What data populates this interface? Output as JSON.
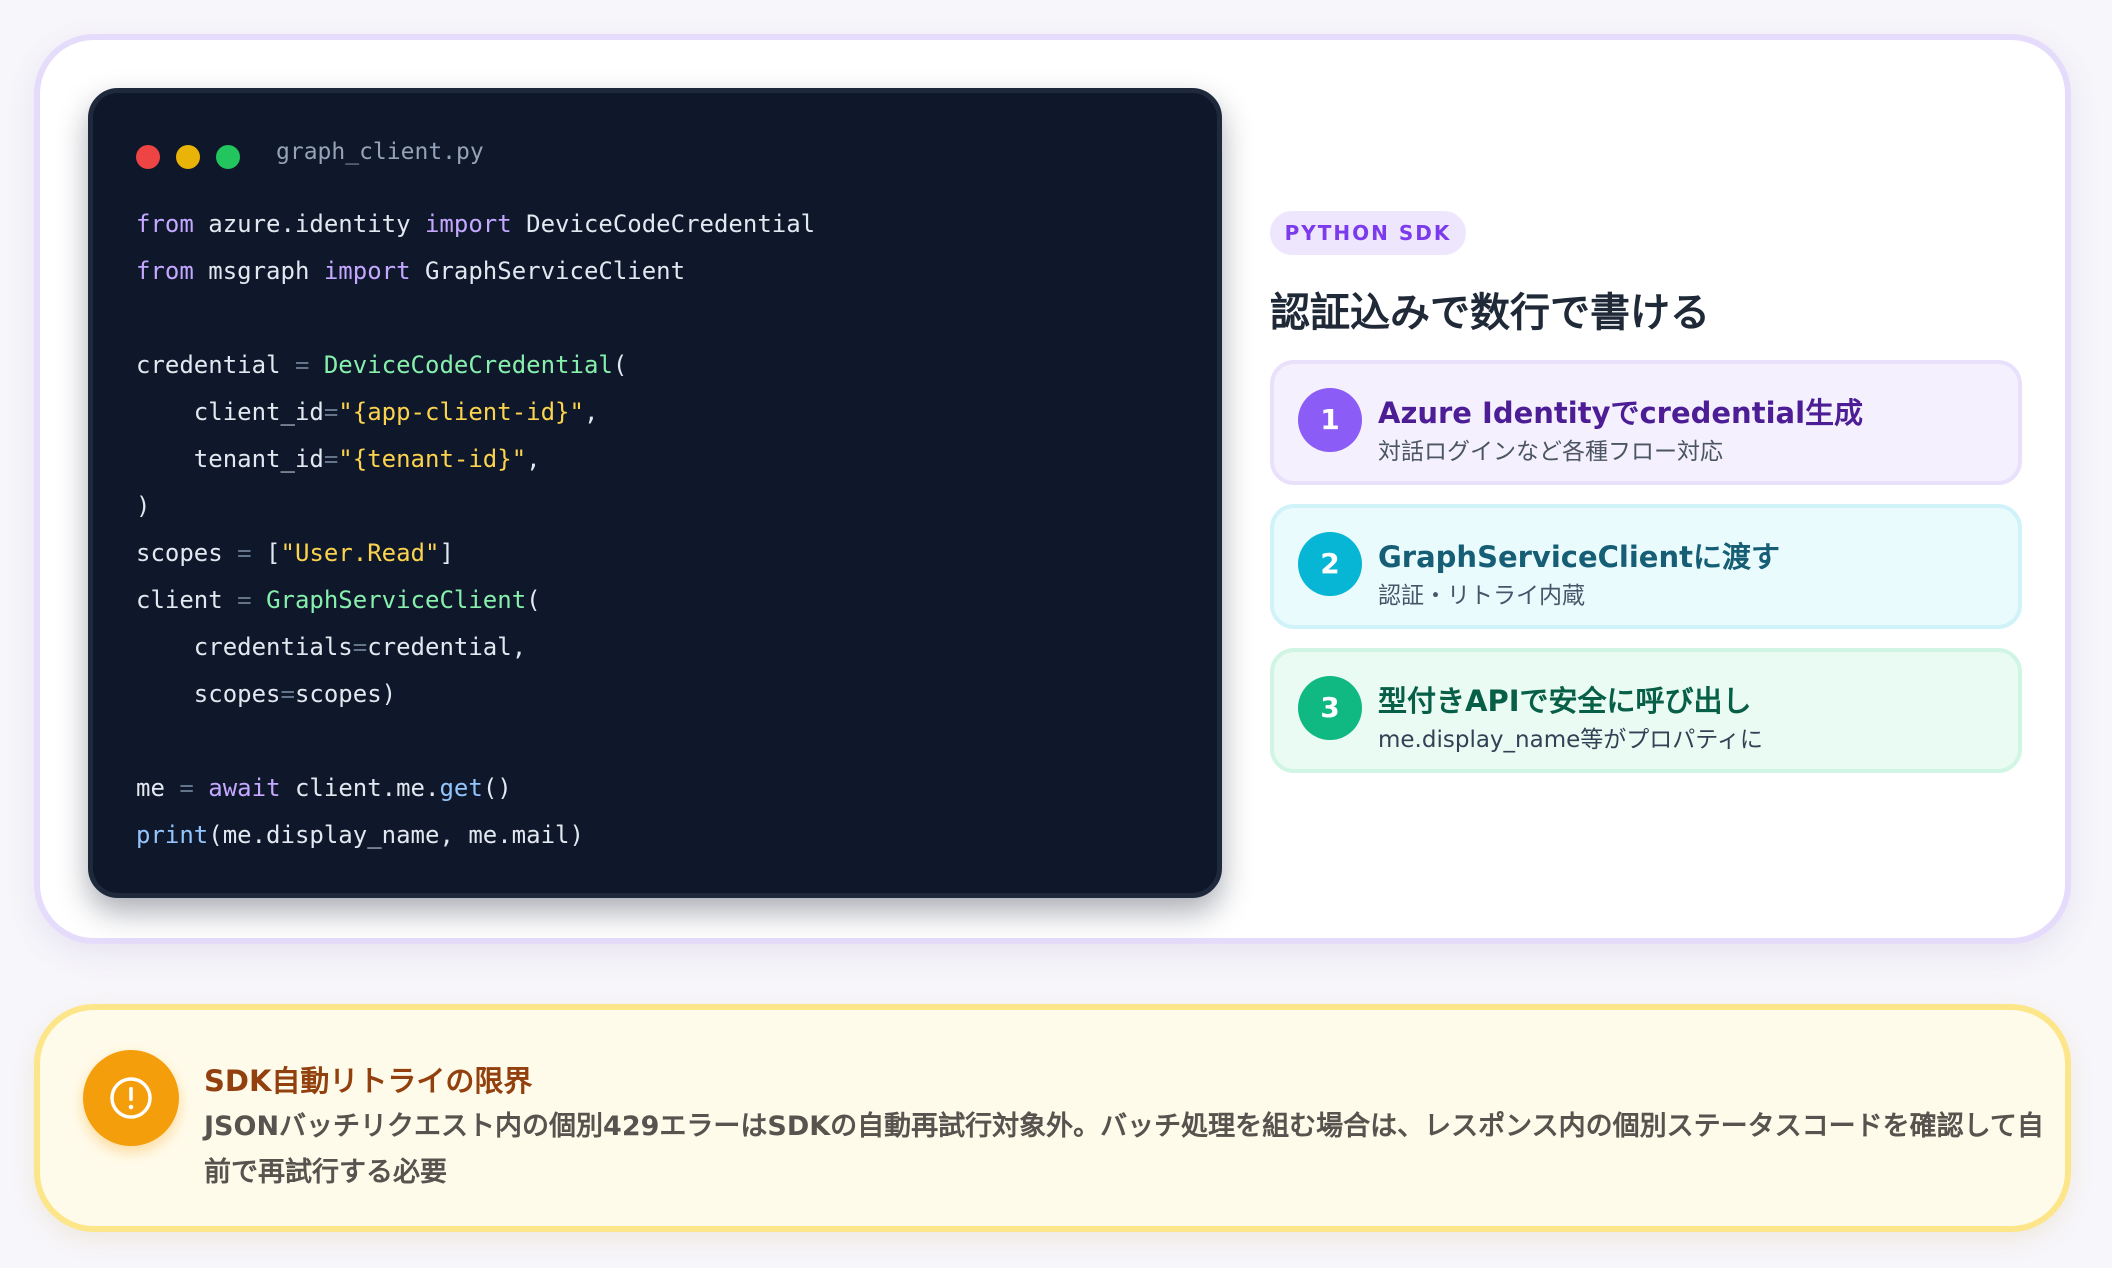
{
  "code_window": {
    "file_name": "graph_client.py",
    "lines": [
      [
        {
          "t": "kw",
          "v": "from"
        },
        {
          "t": "",
          "v": " azure.identity "
        },
        {
          "t": "kw",
          "v": "import"
        },
        {
          "t": "",
          "v": " DeviceCodeCredential"
        }
      ],
      [
        {
          "t": "kw",
          "v": "from"
        },
        {
          "t": "",
          "v": " msgraph "
        },
        {
          "t": "kw",
          "v": "import"
        },
        {
          "t": "",
          "v": " GraphServiceClient"
        }
      ],
      [],
      [
        {
          "t": "",
          "v": "credential "
        },
        {
          "t": "op",
          "v": "="
        },
        {
          "t": "",
          "v": " "
        },
        {
          "t": "fn",
          "v": "DeviceCodeCredential"
        },
        {
          "t": "",
          "v": "("
        }
      ],
      [
        {
          "t": "",
          "v": "    client_id"
        },
        {
          "t": "op",
          "v": "="
        },
        {
          "t": "str",
          "v": "\"{app-client-id}\""
        },
        {
          "t": "",
          "v": ","
        }
      ],
      [
        {
          "t": "",
          "v": "    tenant_id"
        },
        {
          "t": "op",
          "v": "="
        },
        {
          "t": "str",
          "v": "\"{tenant-id}\""
        },
        {
          "t": "",
          "v": ","
        }
      ],
      [
        {
          "t": "",
          "v": ")"
        }
      ],
      [
        {
          "t": "",
          "v": "scopes "
        },
        {
          "t": "op",
          "v": "="
        },
        {
          "t": "",
          "v": " ["
        },
        {
          "t": "str",
          "v": "\"User.Read\""
        },
        {
          "t": "",
          "v": "]"
        }
      ],
      [
        {
          "t": "",
          "v": "client "
        },
        {
          "t": "op",
          "v": "="
        },
        {
          "t": "",
          "v": " "
        },
        {
          "t": "fn",
          "v": "GraphServiceClient"
        },
        {
          "t": "",
          "v": "("
        }
      ],
      [
        {
          "t": "",
          "v": "    credentials"
        },
        {
          "t": "op",
          "v": "="
        },
        {
          "t": "",
          "v": "credential,"
        }
      ],
      [
        {
          "t": "",
          "v": "    scopes"
        },
        {
          "t": "op",
          "v": "="
        },
        {
          "t": "",
          "v": "scopes)"
        }
      ],
      [],
      [
        {
          "t": "",
          "v": "me "
        },
        {
          "t": "op",
          "v": "="
        },
        {
          "t": "",
          "v": " "
        },
        {
          "t": "kw",
          "v": "await"
        },
        {
          "t": "",
          "v": " client.me."
        },
        {
          "t": "call",
          "v": "get"
        },
        {
          "t": "",
          "v": "()"
        }
      ],
      [
        {
          "t": "call",
          "v": "print"
        },
        {
          "t": "",
          "v": "(me.display_name, me.mail)"
        }
      ]
    ]
  },
  "badge": "PYTHON SDK",
  "heading": "認証込みで数行で書ける",
  "steps": [
    {
      "num": "1",
      "title": "Azure Identityでcredential生成",
      "desc": "対話ログインなど各種フロー対応"
    },
    {
      "num": "2",
      "title": "GraphServiceClientに渡す",
      "desc": "認証・リトライ内蔵"
    },
    {
      "num": "3",
      "title": "型付きAPIで安全に呼び出し",
      "desc": "me.display_name等がプロパティに"
    }
  ],
  "alert": {
    "icon": "exclamation-circle-icon",
    "title": "SDK自動リトライの限界",
    "body": "JSONバッチリクエスト内の個別429エラーはSDKの自動再試行対象外。バッチ処理を組む場合は、レスポンス内の個別ステータスコードを確認して自前で再試行する必要"
  },
  "colors": {
    "accent_purple": "#8b5cf6",
    "accent_cyan": "#06b6d4",
    "accent_green": "#10b981",
    "warning": "#f59e0b",
    "code_bg": "#0f172a"
  }
}
